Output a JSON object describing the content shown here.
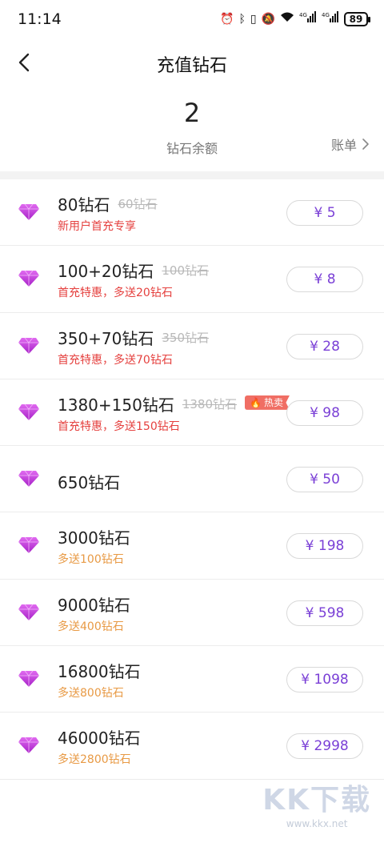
{
  "status_bar": {
    "time": "11:14",
    "battery": "89",
    "icons": [
      "alarm-icon",
      "bluetooth-icon",
      "vibrate-icon",
      "mute-icon",
      "wifi-icon",
      "signal-4g-icon",
      "signal-4g-icon"
    ],
    "signal_label": "4G"
  },
  "nav": {
    "title": "充值钻石",
    "back_icon": "chevron-left-icon"
  },
  "balance": {
    "value": "2",
    "label": "钻石余额",
    "bill_label": "账单"
  },
  "items": [
    {
      "name": "80钻石",
      "original": "60钻石",
      "subtitle": "新用户首充专享",
      "subtitle_color": "red",
      "price": "¥ 5",
      "hot": false
    },
    {
      "name": "100+20钻石",
      "original": "100钻石",
      "subtitle": "首充特惠，多送20钻石",
      "subtitle_color": "red",
      "price": "¥ 8",
      "hot": false
    },
    {
      "name": "350+70钻石",
      "original": "350钻石",
      "subtitle": "首充特惠，多送70钻石",
      "subtitle_color": "red",
      "price": "¥ 28",
      "hot": false
    },
    {
      "name": "1380+150钻石",
      "original": "1380钻石",
      "subtitle": "首充特惠，多送150钻石",
      "subtitle_color": "red",
      "price": "¥ 98",
      "hot": true,
      "hot_label": "热卖"
    },
    {
      "name": "650钻石",
      "original": "",
      "subtitle": "",
      "subtitle_color": "",
      "price": "¥ 50",
      "hot": false
    },
    {
      "name": "3000钻石",
      "original": "",
      "subtitle": "多送100钻石",
      "subtitle_color": "orange",
      "price": "¥ 198",
      "hot": false
    },
    {
      "name": "9000钻石",
      "original": "",
      "subtitle": "多送400钻石",
      "subtitle_color": "orange",
      "price": "¥ 598",
      "hot": false
    },
    {
      "name": "16800钻石",
      "original": "",
      "subtitle": "多送800钻石",
      "subtitle_color": "orange",
      "price": "¥ 1098",
      "hot": false
    },
    {
      "name": "46000钻石",
      "original": "",
      "subtitle": "多送2800钻石",
      "subtitle_color": "orange",
      "price": "¥ 2998",
      "hot": false
    }
  ],
  "watermark": {
    "text": "KK下载",
    "url": "www.kkx.net"
  },
  "colors": {
    "accent": "#7a3fd6",
    "gem": "#c43fe0",
    "red": "#e5413f",
    "orange": "#e89a45",
    "hot_badge": "#f06e64"
  }
}
